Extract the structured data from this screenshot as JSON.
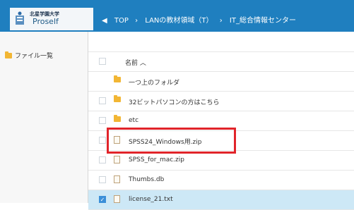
{
  "header": {
    "logo_sub": "北星学園大学",
    "logo_main": "Proself",
    "breadcrumb": [
      "TOP",
      "LANの教材領域（T）",
      "IT_総合情報センター"
    ]
  },
  "sidebar": {
    "items": [
      {
        "label": "ファイル一覧"
      }
    ]
  },
  "file_list": {
    "column_header": "名前 ︿",
    "rows": [
      {
        "name": "一つ上のフォルダ",
        "type": "folder",
        "checkbox": false
      },
      {
        "name": "32ビットパソコンの方はこちら",
        "type": "folder",
        "checkbox": true
      },
      {
        "name": "etc",
        "type": "folder",
        "checkbox": true
      },
      {
        "name": "SPSS24_Windows用.zip",
        "type": "file",
        "checkbox": true
      },
      {
        "name": "SPSS_for_mac.zip",
        "type": "file",
        "checkbox": true
      },
      {
        "name": "Thumbs.db",
        "type": "file",
        "checkbox": true
      },
      {
        "name": "license_21.txt",
        "type": "file",
        "checkbox": true,
        "checked": true
      }
    ]
  },
  "colors": {
    "topbar": "#1f7fbf",
    "selected_row": "#cde8f6",
    "highlight_border": "#e1242a",
    "folder": "#f2b634"
  }
}
